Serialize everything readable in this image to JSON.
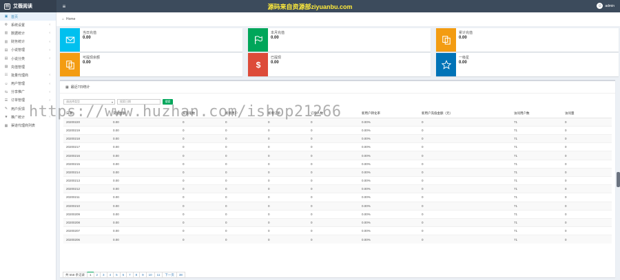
{
  "app": {
    "name": "艾薇阅读"
  },
  "banner": "源码来自资源部ziyuanbu.com",
  "header": {
    "user_name": "admin"
  },
  "sidebar": {
    "items": [
      {
        "label": "首页",
        "icon": "home-icon",
        "active": true,
        "arrow": false
      },
      {
        "label": "系统设置",
        "icon": "gear-icon",
        "active": false,
        "arrow": true
      },
      {
        "label": "数据统计",
        "icon": "bar-chart-icon",
        "active": false,
        "arrow": true
      },
      {
        "label": "财务统计",
        "icon": "bar-chart-icon",
        "active": false,
        "arrow": true
      },
      {
        "label": "小说管理",
        "icon": "book-icon",
        "active": false,
        "arrow": true
      },
      {
        "label": "小说分类",
        "icon": "book-icon",
        "active": false,
        "arrow": true
      },
      {
        "label": "充值管理",
        "icon": "money-icon",
        "active": false,
        "arrow": false
      },
      {
        "label": "批量代理商",
        "icon": "users-icon",
        "active": false,
        "arrow": true
      },
      {
        "label": "用户管理",
        "icon": "user-icon",
        "active": false,
        "arrow": true
      },
      {
        "label": "分享推广",
        "icon": "share-icon",
        "active": false,
        "arrow": true
      },
      {
        "label": "订单管理",
        "icon": "list-icon",
        "active": false,
        "arrow": true
      },
      {
        "label": "用户反馈",
        "icon": "comment-icon",
        "active": false,
        "arrow": false
      },
      {
        "label": "推广统计",
        "icon": "star-icon",
        "active": false,
        "arrow": true
      },
      {
        "label": "渠道代理商列表",
        "icon": "table-icon",
        "active": false,
        "arrow": false
      }
    ]
  },
  "breadcrumb": {
    "label": "Home"
  },
  "stats": [
    {
      "label": "当日充值",
      "value": "0.00",
      "color": "#00c0ef",
      "icon": "envelope-icon"
    },
    {
      "label": "本月充值",
      "value": "0.00",
      "color": "#00a65a",
      "icon": "flag-icon"
    },
    {
      "label": "累计充值",
      "value": "0.00",
      "color": "#f39c12",
      "icon": "copy-icon"
    },
    {
      "label": "可提现余额",
      "value": "0.00",
      "color": "#f39c12",
      "icon": "copy-icon"
    },
    {
      "label": "已提现",
      "value": "0.00",
      "color": "#dd4b39",
      "icon": "dollar-icon"
    },
    {
      "label": "一级星",
      "value": "0.00",
      "color": "#0073b7",
      "icon": "star-icon"
    }
  ],
  "panel": {
    "title": "最近7日统计"
  },
  "filters": {
    "select_placeholder": "请选择类型",
    "input_placeholder": "搜索日期",
    "search_label": "搜索"
  },
  "table": {
    "columns": [
      "日期",
      "充值金额",
      "充值笔数",
      "新增用户",
      "新增订单",
      "订单人数",
      "新用户转化率",
      "新用户充值金额（元）",
      "访问用户数",
      "访问量"
    ],
    "rows": [
      [
        "20200220",
        "0.00",
        "0",
        "0",
        "0",
        "0",
        "0.00%",
        "0",
        "71",
        "0"
      ],
      [
        "20200219",
        "0.00",
        "0",
        "0",
        "0",
        "0",
        "0.00%",
        "0",
        "71",
        "0"
      ],
      [
        "20200218",
        "0.00",
        "0",
        "0",
        "0",
        "0",
        "0.00%",
        "0",
        "71",
        "0"
      ],
      [
        "20200217",
        "0.00",
        "0",
        "0",
        "0",
        "0",
        "0.00%",
        "0",
        "71",
        "0"
      ],
      [
        "20200216",
        "0.00",
        "0",
        "0",
        "0",
        "0",
        "0.00%",
        "0",
        "71",
        "0"
      ],
      [
        "20200215",
        "0.00",
        "0",
        "0",
        "0",
        "0",
        "0.00%",
        "0",
        "71",
        "0"
      ],
      [
        "20200214",
        "0.00",
        "0",
        "0",
        "0",
        "0",
        "0.00%",
        "0",
        "71",
        "0"
      ],
      [
        "20200213",
        "0.00",
        "0",
        "0",
        "0",
        "0",
        "0.00%",
        "0",
        "71",
        "0"
      ],
      [
        "20200212",
        "0.00",
        "0",
        "0",
        "0",
        "0",
        "0.00%",
        "0",
        "71",
        "0"
      ],
      [
        "20200211",
        "0.00",
        "0",
        "0",
        "0",
        "0",
        "0.00%",
        "0",
        "71",
        "0"
      ],
      [
        "20200210",
        "0.00",
        "0",
        "0",
        "0",
        "0",
        "0.00%",
        "0",
        "71",
        "0"
      ],
      [
        "20200209",
        "0.00",
        "0",
        "0",
        "0",
        "0",
        "0.00%",
        "0",
        "71",
        "0"
      ],
      [
        "20200208",
        "0.00",
        "0",
        "0",
        "0",
        "0",
        "0.00%",
        "0",
        "71",
        "0"
      ],
      [
        "20200207",
        "0.00",
        "0",
        "0",
        "0",
        "0",
        "0.00%",
        "0",
        "71",
        "0"
      ],
      [
        "20200206",
        "0.00",
        "0",
        "0",
        "0",
        "0",
        "0.00%",
        "0",
        "71",
        "0"
      ]
    ]
  },
  "pagination": {
    "summary": "共 558 条记录",
    "pages": [
      "1",
      "2",
      "3",
      "4",
      "5",
      "6",
      "7",
      "8",
      "9",
      "10",
      "11"
    ],
    "current": "1",
    "next_label": "下一页",
    "last_page": "38"
  },
  "watermark": "https://www.huzhan.com/ishop21266"
}
